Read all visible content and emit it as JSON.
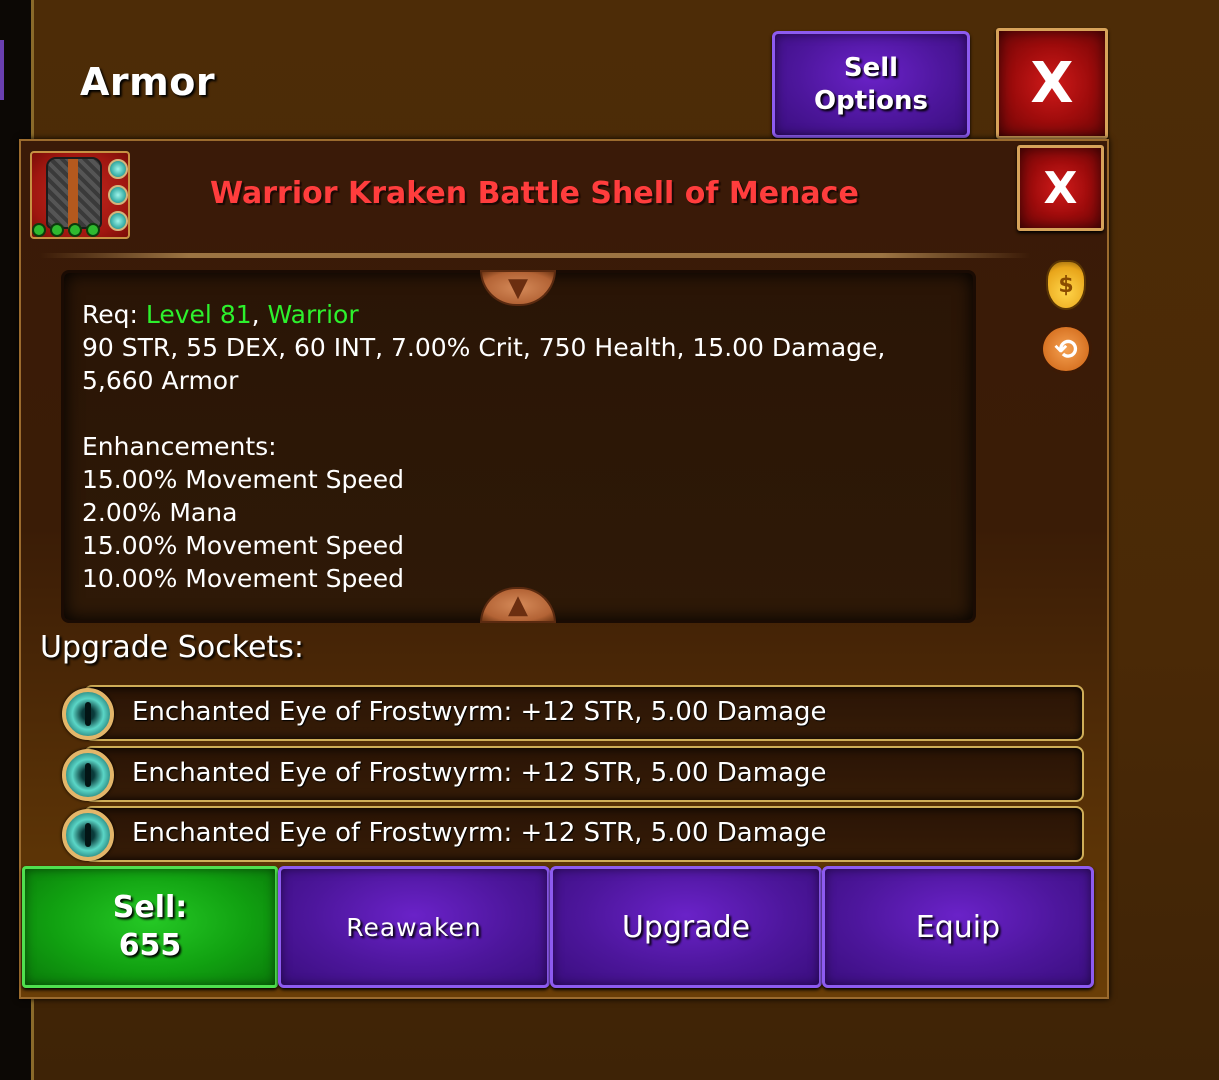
{
  "header": {
    "title": "Armor",
    "sell_options_label": "Sell Options",
    "close_label": "X"
  },
  "item": {
    "name": "Warrior Kraken Battle Shell of Menace",
    "name_color": "#ff3d3d",
    "close_label": "X",
    "icon": "armor-chest-icon",
    "socket_count": 3,
    "level_pips": 4
  },
  "description": {
    "req_label": "Req:",
    "req_level": "Level 81",
    "req_sep": ",",
    "req_class": "Warrior",
    "stats_line1": "90 STR, 55 DEX, 60 INT, 7.00% Crit, 750 Health, 15.00 Damage,",
    "stats_line2": "5,660 Armor",
    "enhancements_title": "Enhancements:",
    "enhancements": [
      "15.00% Movement Speed",
      "2.00% Mana",
      "15.00% Movement Speed",
      "10.00% Movement Speed"
    ]
  },
  "side_icons": {
    "money": "money-bag-icon",
    "reawaken": "reawaken-swirl-icon"
  },
  "sockets": {
    "title": "Upgrade Sockets:",
    "rows": [
      "Enchanted Eye of Frostwyrm: +12 STR, 5.00 Damage",
      "Enchanted Eye of Frostwyrm: +12 STR, 5.00 Damage",
      "Enchanted Eye of Frostwyrm: +12 STR, 5.00 Damage"
    ]
  },
  "actions": {
    "sell_label": "Sell:",
    "sell_value": "655",
    "reawaken_label": "Reawaken",
    "upgrade_label": "Upgrade",
    "equip_label": "Equip"
  },
  "colors": {
    "requirement_green": "#2df12d",
    "purple_button": "#4d169c",
    "green_button": "#11a111",
    "red_button": "#a00c0c"
  }
}
